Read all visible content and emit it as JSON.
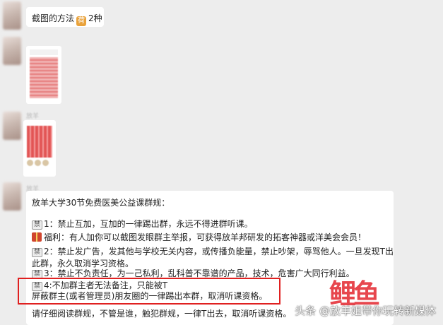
{
  "messages": {
    "first": {
      "text": "截图的方法",
      "badge": "荷",
      "count": "2种"
    },
    "nick_blurred": "放羊"
  },
  "rules": {
    "title": "放羊大学30节免费医美公益课群规：",
    "tag_label": "禁",
    "line1": "1：禁止互加，互加的一律踢出群，永远不得进群听课。",
    "line2": "福利：有人加你可以截图发眼群主举报，可获得放羊邦研发的拓客神器或洋美会会员！",
    "line3a": "2：禁止发广告，发其他与学校无关内容，或传播负能量，禁止吵架，辱骂他人。一旦发现T出",
    "line3b": "此群，永久取消学习资格。",
    "line4": "3：禁止不负责任，为一己私利，乱科普不靠谱的产品，技术，危害广大同行利益。",
    "line5a": "4:不加群主者无法备注，只能被T",
    "line5b": "屏蔽群主(或者管理员)朋友圈的一律踢出本群，取消听课资格。",
    "line6": "请仔细阅读群规，不管是谁，触犯群规，一律T出去，取消听课资格。"
  },
  "watermark": "头条 @放羊姐带你玩转新媒体",
  "logo_text": "鲤鱼",
  "colors": {
    "highlight": "#e02020",
    "background": "#ededed"
  }
}
